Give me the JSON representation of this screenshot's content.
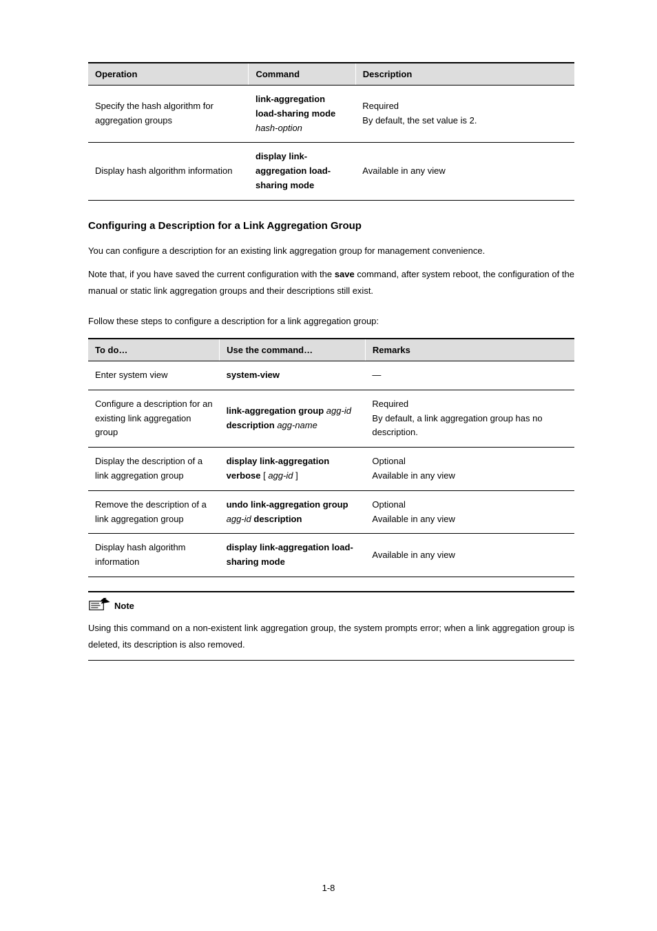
{
  "table1": {
    "headers": [
      "Operation",
      "Command",
      "Description"
    ],
    "rows": [
      {
        "operation": "Specify the hash algorithm for aggregation groups",
        "command_html": "<b>link-aggregation load-sharing mode</b> <i>hash-option</i>",
        "description_html": "Required<br>By default, the set value is 2."
      },
      {
        "operation": "Display hash algorithm information",
        "command_html": "<b>display link-aggregation load-sharing mode</b>",
        "description_html": "Available in any view"
      }
    ]
  },
  "section": {
    "heading": "Configuring a Description for a Link Aggregation Group",
    "para1": "You can configure a description for an existing link aggregation group for management convenience.",
    "para2_html": "Note that, if you have saved the current configuration with the <b>save</b> command, after system reboot, the configuration of the manual or static link aggregation groups and their descriptions still exist.",
    "follow": "Follow these steps to configure a description for a link aggregation group:"
  },
  "table2": {
    "headers": [
      "To do…",
      "Use the command…",
      "Remarks"
    ],
    "rows": [
      {
        "todo": "Enter system view",
        "command_html": "<b>system-view</b>",
        "remarks": "—"
      },
      {
        "todo": "Configure a description for an existing link aggregation group",
        "command_html": "<b>link-aggregation group</b> <i>agg-id</i> <b>description</b> <i>agg-name</i>",
        "remarks_html": "Required<br>By default, a link aggregation group has no description."
      },
      {
        "todo": "Display the description of a link aggregation group",
        "command_html": "<b>display link-aggregation verbose</b> [ <i>agg-id</i> ]",
        "remarks_html": "Optional<br>Available in any view"
      },
      {
        "todo": "Remove the description of a link aggregation group",
        "command_html": "<b>undo link-aggregation group</b> <i>agg-id</i> <b>description</b>",
        "remarks_html": "Optional<br>Available in any view"
      },
      {
        "todo": "Display hash algorithm information",
        "command_html": "<b>display link-aggregation load-sharing mode</b>",
        "remarks_html": "Available in any view"
      }
    ]
  },
  "note": {
    "label": "Note",
    "text": "Using this command on a non-existent link aggregation group, the system prompts error; when a link aggregation group is deleted, its description is also removed."
  },
  "page_number": "1-8"
}
